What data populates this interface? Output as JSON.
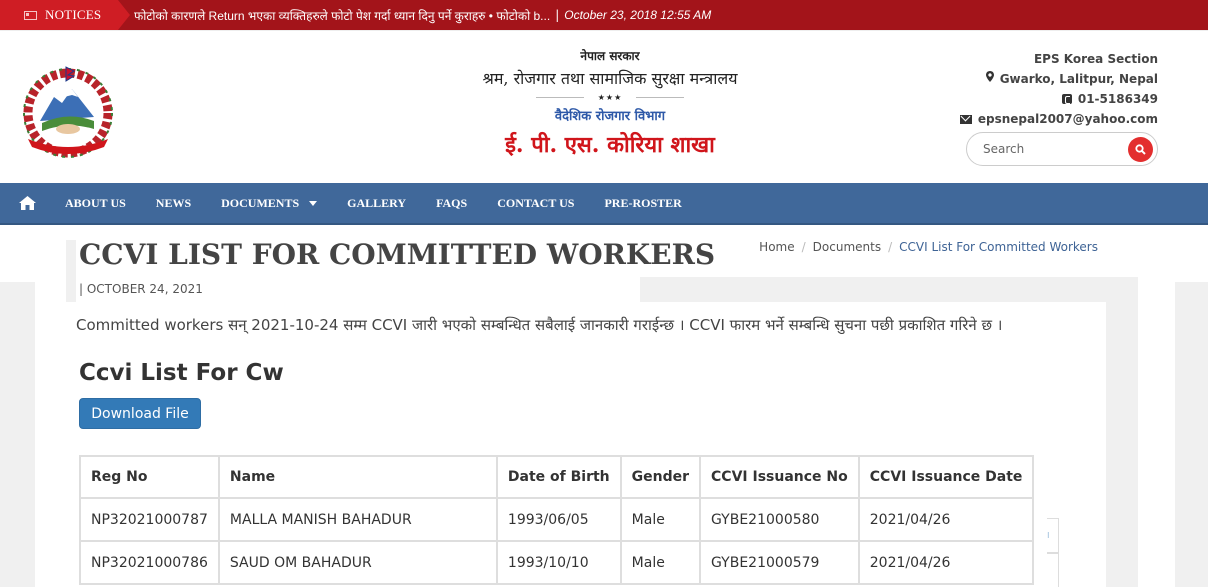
{
  "notice_bar": {
    "label": "NOTICES",
    "icon": "newspaper-icon",
    "text": "फोटोको कारणले Return भएका व्यक्तिहरुले फोटो पेश गर्दा ध्यान दिनु पर्ने कुराहरु • फोटोको b...",
    "separator": "|",
    "date": "October 23, 2018 12:55 AM",
    "colors": {
      "bar": "#a3141a",
      "label": "#cf1d24"
    }
  },
  "header": {
    "emblem": "nepal-government-emblem",
    "government": "नेपाल सरकार",
    "ministry": "श्रम, रोजगार तथा सामाजिक सुरक्षा मन्त्रालय",
    "stars": "★★★",
    "department": "वैदेशिक रोजगार विभाग",
    "branch": "ई. पी. एस. कोरिया शाखा",
    "colors": {
      "department": "#2e59a8",
      "branch": "#d0151b"
    }
  },
  "contact": {
    "section": "EPS Korea Section",
    "address": "Gwarko, Lalitpur, Nepal",
    "phone": "01-5186349",
    "email": "epsnepal2007@yahoo.com",
    "icons": {
      "address": "map-marker-icon",
      "phone": "phone-square-icon",
      "email": "envelope-icon"
    }
  },
  "search": {
    "placeholder": "Search",
    "icon": "search-icon",
    "button_color": "#e32e2e"
  },
  "nav": {
    "home_icon": "home-icon",
    "items": [
      {
        "label": "ABOUT US"
      },
      {
        "label": "NEWS"
      },
      {
        "label": "DOCUMENTS",
        "has_dropdown": true
      },
      {
        "label": "GALLERY"
      },
      {
        "label": "FAQS"
      },
      {
        "label": "CONTACT US"
      },
      {
        "label": "PRE-ROSTER"
      }
    ],
    "color": "#40689a"
  },
  "page": {
    "title": "CCVI LIST FOR COMMITTED WORKERS",
    "date": "| OCTOBER 24, 2021",
    "breadcrumb": [
      {
        "label": "Home"
      },
      {
        "label": "Documents"
      },
      {
        "label": "CCVI List For Committed Workers",
        "current": true
      }
    ],
    "breadcrumb_separator": "/",
    "intro": "Committed workers सन्  2021-10-24 सम्म CCVI जारी भएको सम्बन्धित सबैलाई जानकारी गराईन्छ । CCVI फारम भर्ने सम्बन्धि सुचना पछी प्रकाशित गरिने छ ।",
    "document_title": "Ccvi List For Cw",
    "download_label": "Download File",
    "download_color": "#337ab7"
  },
  "table": {
    "columns": [
      "Reg No",
      "Name",
      "Date of Birth",
      "Gender",
      "CCVI Issuance No",
      "CCVI Issuance Date"
    ],
    "rows": [
      [
        "NP32021000787",
        "MALLA MANISH BAHADUR",
        "1993/06/05",
        "Male",
        "GYBE21000580",
        "2021/04/26"
      ],
      [
        "NP32021000786",
        "SAUD OM BAHADUR",
        "1993/10/10",
        "Male",
        "GYBE21000579",
        "2021/04/26"
      ]
    ]
  }
}
